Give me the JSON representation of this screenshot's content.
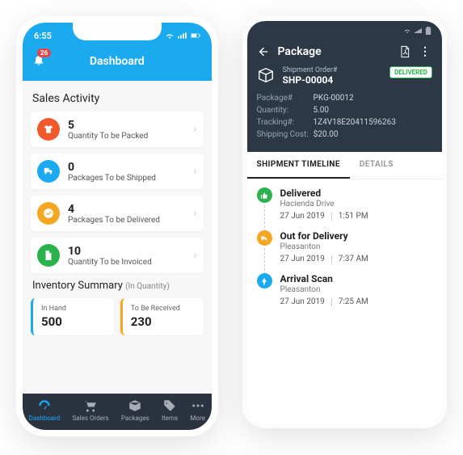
{
  "phone1": {
    "status": {
      "time": "6:55"
    },
    "header": {
      "title": "Dashboard",
      "badge": "26"
    },
    "sales": {
      "title": "Sales Activity",
      "items": [
        {
          "value": "5",
          "label": "Quantity To be Packed",
          "color": "#f15a2b"
        },
        {
          "value": "0",
          "label": "Packages To be Shipped",
          "color": "#1ba9ef"
        },
        {
          "value": "4",
          "label": "Packages To be Delivered",
          "color": "#f5a623"
        },
        {
          "value": "10",
          "label": "Quantity To be Invoiced",
          "color": "#2bb24c"
        }
      ]
    },
    "inventory": {
      "title": "Inventory Summary",
      "unit": "(In Quantity)",
      "in_hand": {
        "label": "In Hand",
        "value": "500"
      },
      "to_receive": {
        "label": "To Be Received",
        "value": "230"
      }
    },
    "tabs": [
      "Dashboard",
      "Sales Orders",
      "Packages",
      "Items",
      "More"
    ]
  },
  "phone2": {
    "header": {
      "title": "Package",
      "shipment_label": "Shipment Order#",
      "shipment_num": "SHP-00004",
      "status": "DELIVERED"
    },
    "meta": {
      "package_label": "Package#",
      "package_value": "PKG-00012",
      "qty_label": "Quantity:",
      "qty_value": "5.00",
      "track_label": "Tracking#:",
      "track_value": "1Z4V18E20411596263",
      "cost_label": "Shipping Cost:",
      "cost_value": "$20.00"
    },
    "tabs": {
      "timeline": "SHIPMENT TIMELINE",
      "details": "DETAILS"
    },
    "timeline": [
      {
        "title": "Delivered",
        "sub": "Hacienda Drive",
        "date": "27 Jun 2019",
        "time": "1:51 PM",
        "color": "#2bb24c"
      },
      {
        "title": "Out for Delivery",
        "sub": "Pleasanton",
        "date": "27 Jun 2019",
        "time": "7:37 AM",
        "color": "#f5a623"
      },
      {
        "title": "Arrival Scan",
        "sub": "Pleasanton",
        "date": "27 Jun 2019",
        "time": "7:25 AM",
        "color": "#1ba9ef"
      }
    ]
  }
}
